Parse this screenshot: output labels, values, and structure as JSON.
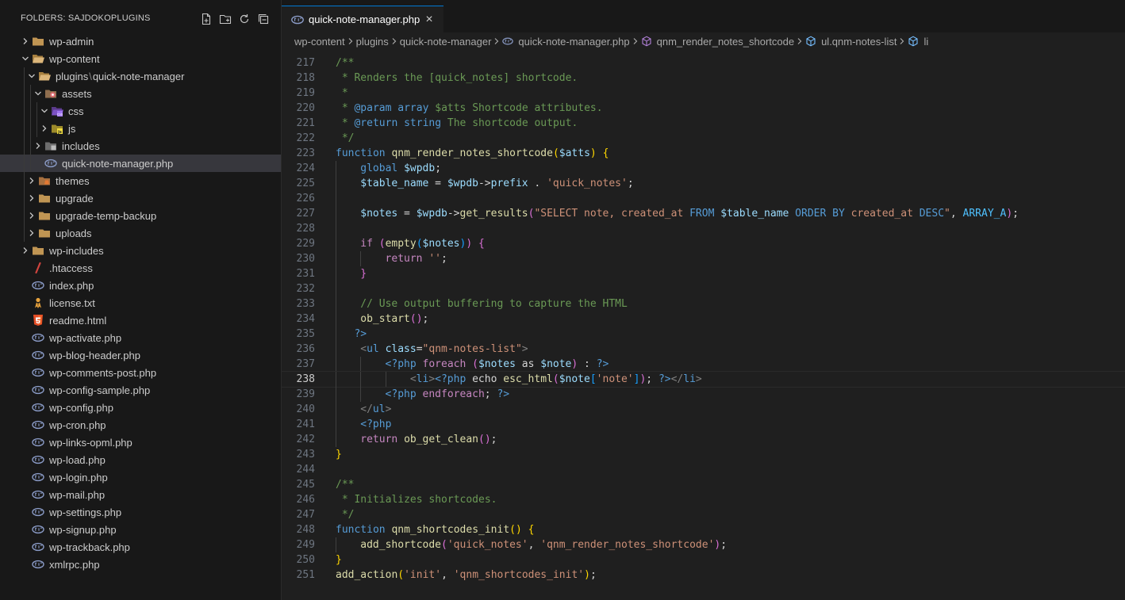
{
  "sidebar": {
    "title": "FOLDERS: SAJDOKOPLUGINS",
    "actions": [
      "new-file-icon",
      "new-folder-icon",
      "refresh-icon",
      "collapse-all-icon"
    ],
    "tree": [
      {
        "label": "wp-admin",
        "depth": 0,
        "type": "folder",
        "expanded": false,
        "icon": "folder-icon"
      },
      {
        "label": "wp-content",
        "depth": 0,
        "type": "folder",
        "expanded": true,
        "icon": "folder-open-icon"
      },
      {
        "label": "plugins",
        "label2": "quick-note-manager",
        "depth": 1,
        "type": "folder",
        "expanded": true,
        "icon": "folder-open-icon"
      },
      {
        "label": "assets",
        "depth": 2,
        "type": "folder",
        "expanded": true,
        "icon": "assets-folder-icon"
      },
      {
        "label": "css",
        "depth": 3,
        "type": "folder",
        "expanded": true,
        "icon": "css-folder-icon"
      },
      {
        "label": "js",
        "depth": 3,
        "type": "folder",
        "expanded": false,
        "icon": "js-folder-icon"
      },
      {
        "label": "includes",
        "depth": 2,
        "type": "folder",
        "expanded": false,
        "icon": "includes-folder-icon"
      },
      {
        "label": "quick-note-manager.php",
        "depth": 2,
        "type": "file",
        "icon": "php-file-icon",
        "selected": true
      },
      {
        "label": "themes",
        "depth": 1,
        "type": "folder",
        "expanded": false,
        "icon": "themes-folder-icon"
      },
      {
        "label": "upgrade",
        "depth": 1,
        "type": "folder",
        "expanded": false,
        "icon": "folder-icon"
      },
      {
        "label": "upgrade-temp-backup",
        "depth": 1,
        "type": "folder",
        "expanded": false,
        "icon": "folder-icon"
      },
      {
        "label": "uploads",
        "depth": 1,
        "type": "folder",
        "expanded": false,
        "icon": "folder-icon"
      },
      {
        "label": "wp-includes",
        "depth": 0,
        "type": "folder",
        "expanded": false,
        "icon": "folder-icon"
      },
      {
        "label": ".htaccess",
        "depth": 0,
        "type": "file",
        "icon": "htaccess-file-icon"
      },
      {
        "label": "index.php",
        "depth": 0,
        "type": "file",
        "icon": "php-file-icon"
      },
      {
        "label": "license.txt",
        "depth": 0,
        "type": "file",
        "icon": "license-file-icon"
      },
      {
        "label": "readme.html",
        "depth": 0,
        "type": "file",
        "icon": "html5-file-icon"
      },
      {
        "label": "wp-activate.php",
        "depth": 0,
        "type": "file",
        "icon": "php-file-icon"
      },
      {
        "label": "wp-blog-header.php",
        "depth": 0,
        "type": "file",
        "icon": "php-file-icon"
      },
      {
        "label": "wp-comments-post.php",
        "depth": 0,
        "type": "file",
        "icon": "php-file-icon"
      },
      {
        "label": "wp-config-sample.php",
        "depth": 0,
        "type": "file",
        "icon": "php-file-icon"
      },
      {
        "label": "wp-config.php",
        "depth": 0,
        "type": "file",
        "icon": "php-file-icon"
      },
      {
        "label": "wp-cron.php",
        "depth": 0,
        "type": "file",
        "icon": "php-file-icon"
      },
      {
        "label": "wp-links-opml.php",
        "depth": 0,
        "type": "file",
        "icon": "php-file-icon"
      },
      {
        "label": "wp-load.php",
        "depth": 0,
        "type": "file",
        "icon": "php-file-icon"
      },
      {
        "label": "wp-login.php",
        "depth": 0,
        "type": "file",
        "icon": "php-file-icon"
      },
      {
        "label": "wp-mail.php",
        "depth": 0,
        "type": "file",
        "icon": "php-file-icon"
      },
      {
        "label": "wp-settings.php",
        "depth": 0,
        "type": "file",
        "icon": "php-file-icon"
      },
      {
        "label": "wp-signup.php",
        "depth": 0,
        "type": "file",
        "icon": "php-file-icon"
      },
      {
        "label": "wp-trackback.php",
        "depth": 0,
        "type": "file",
        "icon": "php-file-icon"
      },
      {
        "label": "xmlrpc.php",
        "depth": 0,
        "type": "file",
        "icon": "php-file-icon"
      }
    ]
  },
  "editor": {
    "tab": {
      "label": "quick-note-manager.php",
      "close": "×",
      "icon": "php-file-icon"
    },
    "breadcrumb": [
      {
        "label": "wp-content",
        "icon": ""
      },
      {
        "label": "plugins",
        "icon": ""
      },
      {
        "label": "quick-note-manager",
        "icon": ""
      },
      {
        "label": "quick-note-manager.php",
        "icon": "php-file-icon"
      },
      {
        "label": "qnm_render_notes_shortcode",
        "icon": "method-cube-icon"
      },
      {
        "label": "ul.qnm-notes-list",
        "icon": "element-cube-icon"
      },
      {
        "label": "li",
        "icon": "element-cube-icon"
      }
    ],
    "current_line": 238,
    "lines": [
      {
        "n": 217,
        "ind": 0,
        "tokens": [
          [
            "/**",
            "comment"
          ]
        ]
      },
      {
        "n": 218,
        "ind": 0,
        "tokens": [
          [
            " * Renders the [quick_notes] shortcode.",
            "comment"
          ]
        ]
      },
      {
        "n": 219,
        "ind": 0,
        "tokens": [
          [
            " *",
            "comment"
          ]
        ]
      },
      {
        "n": 220,
        "ind": 0,
        "tokens": [
          [
            " * ",
            "comment"
          ],
          [
            "@param",
            "doctag"
          ],
          [
            " ",
            "comment"
          ],
          [
            "array",
            "doctag"
          ],
          [
            " $atts Shortcode attributes.",
            "comment"
          ]
        ]
      },
      {
        "n": 221,
        "ind": 0,
        "tokens": [
          [
            " * ",
            "comment"
          ],
          [
            "@return",
            "doctag"
          ],
          [
            " ",
            "comment"
          ],
          [
            "string",
            "doctag"
          ],
          [
            " The shortcode output.",
            "comment"
          ]
        ]
      },
      {
        "n": 222,
        "ind": 0,
        "tokens": [
          [
            " */",
            "comment"
          ]
        ]
      },
      {
        "n": 223,
        "ind": 0,
        "tokens": [
          [
            "function",
            "kw"
          ],
          [
            " ",
            "plain"
          ],
          [
            "qnm_render_notes_shortcode",
            "fn"
          ],
          [
            "(",
            "br1"
          ],
          [
            "$atts",
            "var"
          ],
          [
            ")",
            "br1"
          ],
          [
            " ",
            "plain"
          ],
          [
            "{",
            "br1"
          ]
        ]
      },
      {
        "n": 224,
        "ind": 1,
        "tokens": [
          [
            "global",
            "kw"
          ],
          [
            " ",
            "plain"
          ],
          [
            "$wpdb",
            "var"
          ],
          [
            ";",
            "plain"
          ]
        ]
      },
      {
        "n": 225,
        "ind": 1,
        "tokens": [
          [
            "$table_name",
            "var"
          ],
          [
            " = ",
            "plain"
          ],
          [
            "$wpdb",
            "var"
          ],
          [
            "->",
            "plain"
          ],
          [
            "prefix",
            "var"
          ],
          [
            " . ",
            "plain"
          ],
          [
            "'quick_notes'",
            "str"
          ],
          [
            ";",
            "plain"
          ]
        ]
      },
      {
        "n": 226,
        "ind": 1,
        "tokens": []
      },
      {
        "n": 227,
        "ind": 1,
        "tokens": [
          [
            "$notes",
            "var"
          ],
          [
            " = ",
            "plain"
          ],
          [
            "$wpdb",
            "var"
          ],
          [
            "->",
            "plain"
          ],
          [
            "get_results",
            "fn"
          ],
          [
            "(",
            "br2"
          ],
          [
            "\"SELECT note, created_at ",
            "str"
          ],
          [
            "FROM",
            "kw"
          ],
          [
            " ",
            "str"
          ],
          [
            "$table_name",
            "var"
          ],
          [
            " ",
            "str"
          ],
          [
            "ORDER BY",
            "kw"
          ],
          [
            " created_at ",
            "str"
          ],
          [
            "DESC",
            "kw"
          ],
          [
            "\"",
            "str"
          ],
          [
            ", ",
            "plain"
          ],
          [
            "ARRAY_A",
            "const"
          ],
          [
            ")",
            "br2"
          ],
          [
            ";",
            "plain"
          ]
        ]
      },
      {
        "n": 228,
        "ind": 1,
        "tokens": []
      },
      {
        "n": 229,
        "ind": 1,
        "tokens": [
          [
            "if",
            "ctrl"
          ],
          [
            " ",
            "plain"
          ],
          [
            "(",
            "br2"
          ],
          [
            "empty",
            "fn"
          ],
          [
            "(",
            "br3"
          ],
          [
            "$notes",
            "var"
          ],
          [
            ")",
            "br3"
          ],
          [
            ")",
            "br2"
          ],
          [
            " ",
            "plain"
          ],
          [
            "{",
            "br2"
          ]
        ]
      },
      {
        "n": 230,
        "ind": 2,
        "tokens": [
          [
            "return",
            "ctrl"
          ],
          [
            " ",
            "plain"
          ],
          [
            "''",
            "str"
          ],
          [
            ";",
            "plain"
          ]
        ]
      },
      {
        "n": 231,
        "ind": 1,
        "tokens": [
          [
            "}",
            "br2"
          ]
        ]
      },
      {
        "n": 232,
        "ind": 1,
        "tokens": []
      },
      {
        "n": 233,
        "ind": 1,
        "tokens": [
          [
            "// Use output buffering to capture the HTML",
            "comment"
          ]
        ]
      },
      {
        "n": 234,
        "ind": 1,
        "tokens": [
          [
            "ob_start",
            "fn"
          ],
          [
            "(",
            "br2"
          ],
          [
            ")",
            "br2"
          ],
          [
            ";",
            "plain"
          ]
        ]
      },
      {
        "n": 235,
        "ind": 1,
        "tokens": [
          [
            "?>",
            "php"
          ]
        ],
        "shift": -1
      },
      {
        "n": 236,
        "ind": 1,
        "tokens": [
          [
            "<",
            "tag"
          ],
          [
            "ul",
            "tagname"
          ],
          [
            " ",
            "plain"
          ],
          [
            "class",
            "attr"
          ],
          [
            "=",
            "plain"
          ],
          [
            "\"qnm-notes-list\"",
            "str"
          ],
          [
            ">",
            "tag"
          ]
        ]
      },
      {
        "n": 237,
        "ind": 2,
        "tokens": [
          [
            "<?php",
            "php"
          ],
          [
            " ",
            "plain"
          ],
          [
            "foreach",
            "ctrl"
          ],
          [
            " ",
            "plain"
          ],
          [
            "(",
            "br2"
          ],
          [
            "$notes",
            "var"
          ],
          [
            " as ",
            "plain"
          ],
          [
            "$note",
            "var"
          ],
          [
            ")",
            "br2"
          ],
          [
            " : ",
            "plain"
          ],
          [
            "?>",
            "php"
          ]
        ]
      },
      {
        "n": 238,
        "ind": 3,
        "tokens": [
          [
            "<",
            "tag"
          ],
          [
            "li",
            "tagname"
          ],
          [
            ">",
            "tag"
          ],
          [
            "<?php",
            "php"
          ],
          [
            " echo ",
            "plain"
          ],
          [
            "esc_html",
            "fn"
          ],
          [
            "(",
            "br2"
          ],
          [
            "$note",
            "var"
          ],
          [
            "[",
            "br3"
          ],
          [
            "'note'",
            "str"
          ],
          [
            "]",
            "br3"
          ],
          [
            ")",
            "br2"
          ],
          [
            "; ",
            "plain"
          ],
          [
            "?>",
            "php"
          ],
          [
            "</",
            "tag"
          ],
          [
            "li",
            "tagname"
          ],
          [
            ">",
            "tag"
          ]
        ]
      },
      {
        "n": 239,
        "ind": 2,
        "tokens": [
          [
            "<?php",
            "php"
          ],
          [
            " ",
            "plain"
          ],
          [
            "endforeach",
            "ctrl"
          ],
          [
            "; ",
            "plain"
          ],
          [
            "?>",
            "php"
          ]
        ]
      },
      {
        "n": 240,
        "ind": 1,
        "tokens": [
          [
            "</",
            "tag"
          ],
          [
            "ul",
            "tagname"
          ],
          [
            ">",
            "tag"
          ]
        ]
      },
      {
        "n": 241,
        "ind": 1,
        "tokens": [
          [
            "<?php",
            "php"
          ]
        ]
      },
      {
        "n": 242,
        "ind": 1,
        "tokens": [
          [
            "return",
            "ctrl"
          ],
          [
            " ",
            "plain"
          ],
          [
            "ob_get_clean",
            "fn"
          ],
          [
            "(",
            "br2"
          ],
          [
            ")",
            "br2"
          ],
          [
            ";",
            "plain"
          ]
        ]
      },
      {
        "n": 243,
        "ind": 0,
        "tokens": [
          [
            "}",
            "br1"
          ]
        ]
      },
      {
        "n": 244,
        "ind": 0,
        "tokens": []
      },
      {
        "n": 245,
        "ind": 0,
        "tokens": [
          [
            "/**",
            "comment"
          ]
        ]
      },
      {
        "n": 246,
        "ind": 0,
        "tokens": [
          [
            " * Initializes shortcodes.",
            "comment"
          ]
        ]
      },
      {
        "n": 247,
        "ind": 0,
        "tokens": [
          [
            " */",
            "comment"
          ]
        ]
      },
      {
        "n": 248,
        "ind": 0,
        "tokens": [
          [
            "function",
            "kw"
          ],
          [
            " ",
            "plain"
          ],
          [
            "qnm_shortcodes_init",
            "fn"
          ],
          [
            "(",
            "br1"
          ],
          [
            ")",
            "br1"
          ],
          [
            " ",
            "plain"
          ],
          [
            "{",
            "br1"
          ]
        ]
      },
      {
        "n": 249,
        "ind": 1,
        "tokens": [
          [
            "add_shortcode",
            "fn"
          ],
          [
            "(",
            "br2"
          ],
          [
            "'quick_notes'",
            "str"
          ],
          [
            ", ",
            "plain"
          ],
          [
            "'qnm_render_notes_shortcode'",
            "str"
          ],
          [
            ")",
            "br2"
          ],
          [
            ";",
            "plain"
          ]
        ]
      },
      {
        "n": 250,
        "ind": 0,
        "tokens": [
          [
            "}",
            "br1"
          ]
        ]
      },
      {
        "n": 251,
        "ind": 0,
        "tokens": [
          [
            "add_action",
            "fn"
          ],
          [
            "(",
            "br1"
          ],
          [
            "'init'",
            "str"
          ],
          [
            ", ",
            "plain"
          ],
          [
            "'qnm_shortcodes_init'",
            "str"
          ],
          [
            ")",
            "br1"
          ],
          [
            ";",
            "plain"
          ]
        ]
      }
    ]
  }
}
